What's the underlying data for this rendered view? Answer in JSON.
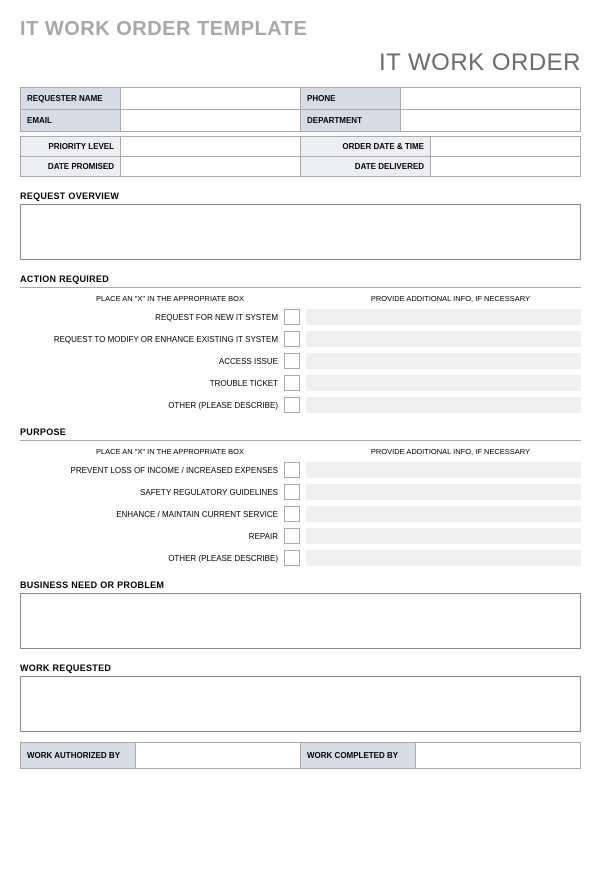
{
  "header": {
    "main_title": "IT WORK ORDER TEMPLATE",
    "sub_title": "IT WORK ORDER"
  },
  "requester": {
    "name_label": "REQUESTER NAME",
    "name_value": "",
    "phone_label": "PHONE",
    "phone_value": "",
    "email_label": "EMAIL",
    "email_value": "",
    "dept_label": "DEPARTMENT",
    "dept_value": ""
  },
  "meta": {
    "priority_label": "PRIORITY LEVEL",
    "priority_value": "",
    "orderdt_label": "ORDER DATE & TIME",
    "orderdt_value": "",
    "promised_label": "DATE PROMISED",
    "promised_value": "",
    "delivered_label": "DATE DELIVERED",
    "delivered_value": ""
  },
  "sections": {
    "overview_heading": "REQUEST OVERVIEW",
    "action_heading": "ACTION REQUIRED",
    "purpose_heading": "PURPOSE",
    "problem_heading": "BUSINESS NEED OR PROBLEM",
    "work_heading": "WORK REQUESTED"
  },
  "hints": {
    "left": "PLACE AN \"X\" IN THE APPROPRIATE BOX",
    "right": "PROVIDE ADDITIONAL INFO, IF NECESSARY"
  },
  "action_items": [
    {
      "label": "REQUEST FOR NEW IT SYSTEM",
      "checked": "",
      "info": ""
    },
    {
      "label": "REQUEST TO MODIFY OR ENHANCE EXISTING IT SYSTEM",
      "checked": "",
      "info": ""
    },
    {
      "label": "ACCESS ISSUE",
      "checked": "",
      "info": ""
    },
    {
      "label": "TROUBLE TICKET",
      "checked": "",
      "info": ""
    },
    {
      "label": "OTHER (PLEASE DESCRIBE)",
      "checked": "",
      "info": ""
    }
  ],
  "purpose_items": [
    {
      "label": "PREVENT LOSS OF INCOME / INCREASED EXPENSES",
      "checked": "",
      "info": ""
    },
    {
      "label": "SAFETY REGULATORY GUIDELINES",
      "checked": "",
      "info": ""
    },
    {
      "label": "ENHANCE / MAINTAIN CURRENT SERVICE",
      "checked": "",
      "info": ""
    },
    {
      "label": "REPAIR",
      "checked": "",
      "info": ""
    },
    {
      "label": "OTHER (PLEASE DESCRIBE)",
      "checked": "",
      "info": ""
    }
  ],
  "overview_value": "",
  "problem_value": "",
  "work_value": "",
  "signoff": {
    "auth_label": "WORK AUTHORIZED BY",
    "auth_value": "",
    "comp_label": "WORK COMPLETED BY",
    "comp_value": ""
  }
}
